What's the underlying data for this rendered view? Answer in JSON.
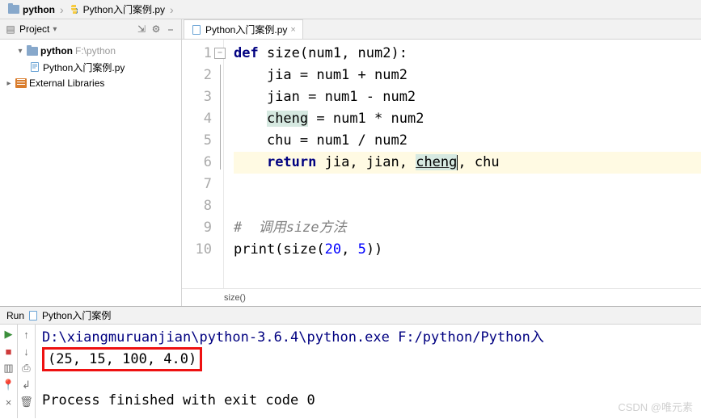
{
  "breadcrumb": {
    "root": "python",
    "file": "Python入门案例.py"
  },
  "project": {
    "header": "Project",
    "root_name": "python",
    "root_path": "F:\\python",
    "file": "Python入门案例.py",
    "external": "External Libraries"
  },
  "editor": {
    "tab": "Python入门案例.py",
    "crumb": "size()",
    "lines": [
      "1",
      "2",
      "3",
      "4",
      "5",
      "6",
      "7",
      "8",
      "9",
      "10"
    ],
    "code": {
      "l1_kw": "def",
      "l1_rest": " size(num1, num2):",
      "l2": "    jia = num1 + num2",
      "l3": "    jian = num1 - num2",
      "l4a": "    ",
      "l4_cheng": "cheng",
      "l4b": " = num1 * num2",
      "l5": "    chu = num1 / num2",
      "l6_pad": "    ",
      "l6_kw": "return",
      "l6_a": " jia, jian, ",
      "l6_cheng": "cheng",
      "l6_b": ", chu",
      "l9_cmt": "#  调用size方法",
      "l10a": "print(size(",
      "l10_n1": "20",
      "l10b": ", ",
      "l10_n2": "5",
      "l10c": "))"
    }
  },
  "run": {
    "title_prefix": "Run",
    "title": "Python入门案例",
    "path": "D:\\xiangmuruanjian\\python-3.6.4\\python.exe F:/python/Python入",
    "output": "(25, 15, 100, 4.0)",
    "exit": "Process finished with exit code 0"
  },
  "watermark": "CSDN @唯元素"
}
